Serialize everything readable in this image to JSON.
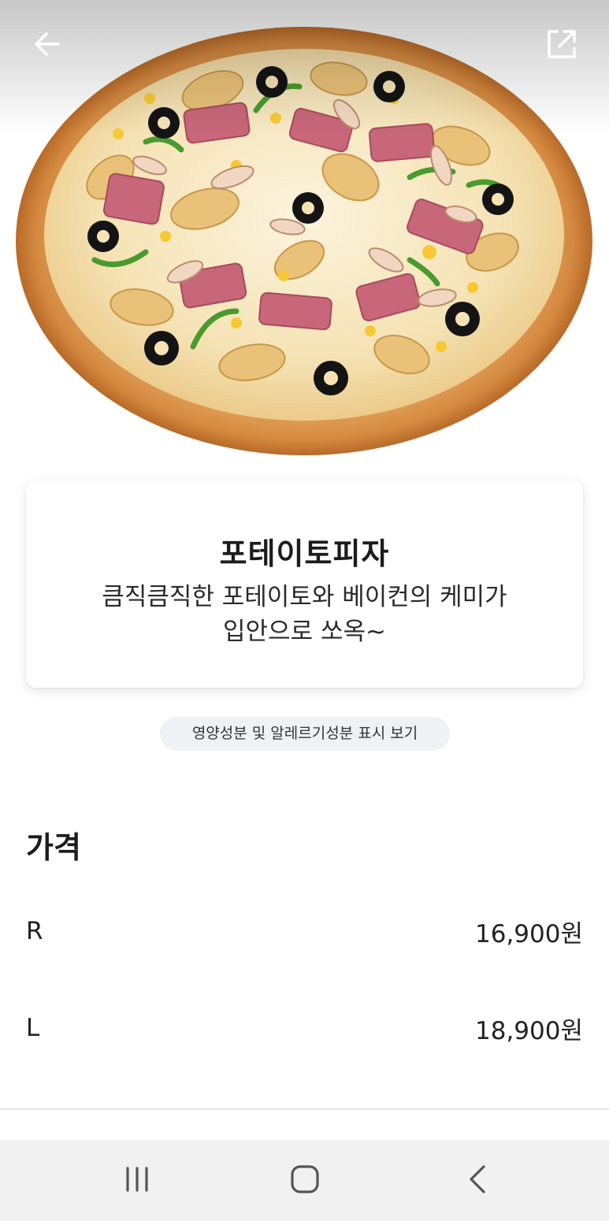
{
  "product": {
    "name": "포테이토피자",
    "description_line1": "큼직큼직한 포테이토와 베이컨의 케미가",
    "description_line2": "입안으로 쏘옥~",
    "image_icon": "pizza-image"
  },
  "header": {
    "back_icon": "arrow-left-icon",
    "share_icon": "share-external-icon"
  },
  "nutrition_link": "영양성분 및 알레르기성분 표시 보기",
  "price_section": {
    "title": "가격",
    "rows": [
      {
        "size": "R",
        "price": "16,900원"
      },
      {
        "size": "L",
        "price": "18,900원"
      }
    ]
  },
  "system_nav": {
    "recent_icon": "recent-apps-icon",
    "home_icon": "home-icon",
    "back_icon": "back-chevron-icon"
  },
  "colors": {
    "text": "#1c1c1c",
    "chip_bg": "#f0f1f4",
    "nav_bg": "#f1f1f1",
    "divider": "#e4e4e4"
  }
}
